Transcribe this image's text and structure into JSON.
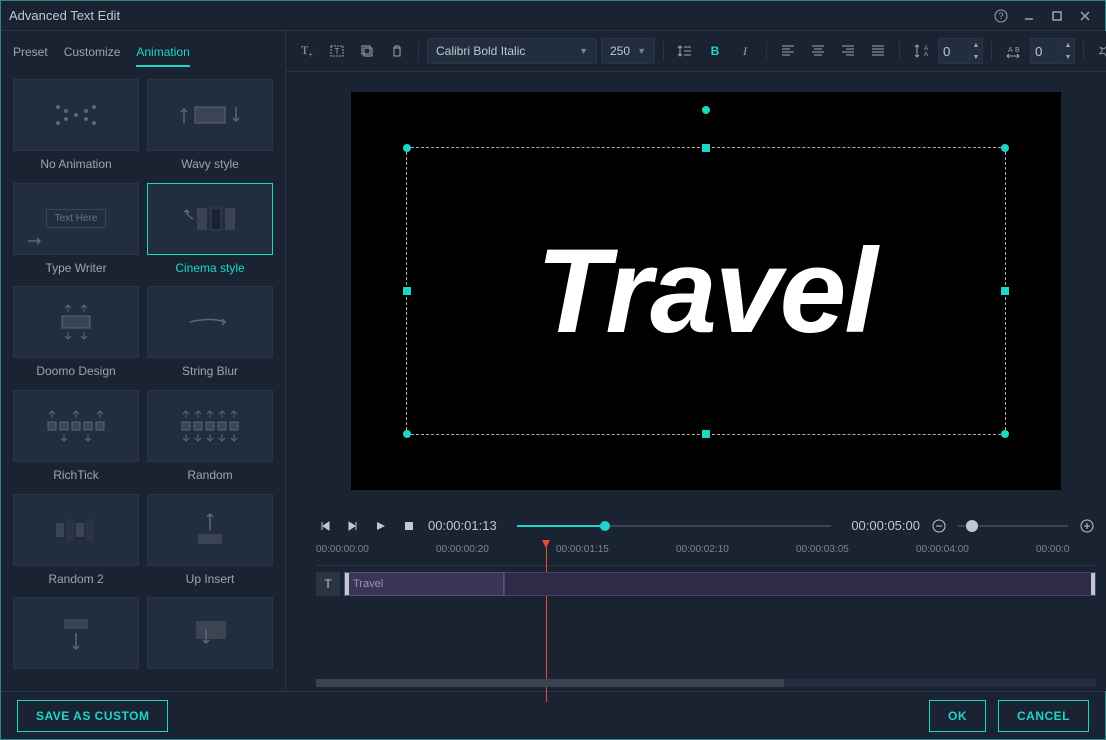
{
  "window": {
    "title": "Advanced Text Edit"
  },
  "tabs": {
    "preset": "Preset",
    "customize": "Customize",
    "animation": "Animation"
  },
  "animations": [
    {
      "label": "No Animation"
    },
    {
      "label": "Wavy style"
    },
    {
      "label": "Type Writer",
      "tw_text": "Text Here"
    },
    {
      "label": "Cinema style",
      "selected": true
    },
    {
      "label": "Doomo Design"
    },
    {
      "label": "String Blur"
    },
    {
      "label": "RichTick"
    },
    {
      "label": "Random"
    },
    {
      "label": "Random 2"
    },
    {
      "label": "Up Insert"
    },
    {
      "label": ""
    },
    {
      "label": ""
    }
  ],
  "toolbar": {
    "font": "Calibri Bold Italic",
    "size": "250",
    "spacing1": "0",
    "spacing2": "0"
  },
  "canvas": {
    "text": "Travel"
  },
  "playback": {
    "current": "00:00:01:13",
    "duration": "00:00:05:00"
  },
  "ruler": {
    "marks": [
      "00:00:00:00",
      "00:00:00:20",
      "00:00:01:15",
      "00:00:02:10",
      "00:00:03:05",
      "00:00:04:00",
      "00:00:0"
    ]
  },
  "clip": {
    "label": "Travel"
  },
  "footer": {
    "save": "SAVE AS CUSTOM",
    "ok": "OK",
    "cancel": "CANCEL"
  }
}
